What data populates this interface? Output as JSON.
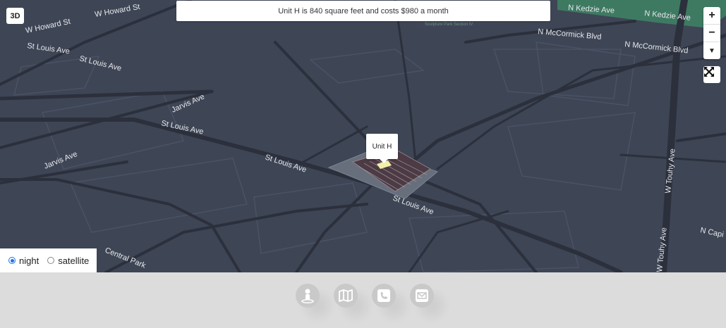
{
  "map": {
    "mode_button": "3D",
    "banner": "Unit H is 840 square feet and costs $980 a month",
    "popup_label": "Unit H",
    "park_label": "Sculpture Park Section IV",
    "streets": {
      "w_howard_st_a": "W Howard St",
      "w_howard_st_b": "W Howard St",
      "st_louis_ave_a": "St Louis Ave",
      "st_louis_ave_b": "St Louis Ave",
      "st_louis_ave_c": "St Louis Ave",
      "st_louis_ave_d": "St Louis Ave",
      "st_louis_ave_e": "St Louis Ave",
      "jarvis_ave_a": "Jarvis Ave",
      "jarvis_ave_b": "Jarvis Ave",
      "central_park": "Central Park",
      "n_kedzie_ave_a": "N Kedzie Ave",
      "n_kedzie_ave_b": "N Kedzie Ave",
      "n_mccormick_a": "N McCormick Blvd",
      "n_mccormick_b": "N McCormick Blvd",
      "w_touhy_a": "W Touhy Ave",
      "w_touhy_b": "W Touhy Ave",
      "n_capi": "N Capi"
    },
    "zoom": {
      "plus": "+",
      "minus": "−",
      "compass": "▼"
    },
    "colors": {
      "background": "#3e4555",
      "road": "#2c323f",
      "park": "#3e7a62",
      "highlight": "#f3f0a8"
    }
  },
  "layers": {
    "night": "night",
    "satellite": "satellite",
    "selected": "night"
  },
  "footer": {
    "icons": [
      "person-pin-icon",
      "map-icon",
      "phone-icon",
      "mail-icon"
    ]
  }
}
